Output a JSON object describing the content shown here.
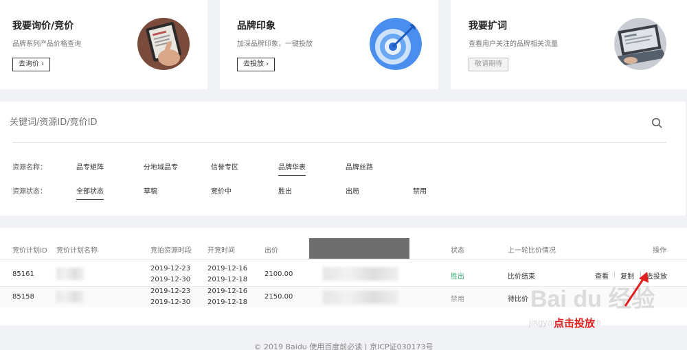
{
  "cards": [
    {
      "title": "我要询价/竞价",
      "desc": "品牌系列产品价格查询",
      "button": "去询价 ›"
    },
    {
      "title": "品牌印象",
      "desc": "加深品牌印象，一键投放",
      "button": "去投放 ›"
    },
    {
      "title": "我要扩词",
      "desc": "查看用户关注的品牌相关流量",
      "button": "敬请期待"
    }
  ],
  "search": {
    "placeholder": "关键词/资源ID/竞价ID"
  },
  "filters": {
    "name_label": "资源名称：",
    "name_options": [
      "品专矩阵",
      "分地域品专",
      "信誉专区",
      "品牌华表",
      "品牌丝路"
    ],
    "status_label": "资源状态：",
    "status_options": [
      "全部状态",
      "草稿",
      "竞价中",
      "胜出",
      "出局",
      "禁用"
    ]
  },
  "table": {
    "headers": [
      "竞价计划ID",
      "竞价计划名称",
      "竞拍资源时段",
      "开竞时间",
      "出价",
      "状态",
      "上一轮比价情况",
      "操作"
    ],
    "rows": [
      {
        "id": "85161",
        "period_start": "2019-12-23",
        "period_end": "2019-12-30",
        "open_start": "2019-12-16",
        "open_end": "2019-12-18",
        "bid": "2100.00",
        "status": "胜出",
        "last_round": "比价结束",
        "ops": [
          "查看",
          "复制",
          "去投放"
        ]
      },
      {
        "id": "85158",
        "period_start": "2019-12-23",
        "period_end": "2019-12-30",
        "open_start": "2019-12-16",
        "open_end": "2019-12-18",
        "bid": "2150.00",
        "status": "禁用",
        "last_round": "待比价",
        "ops": []
      }
    ]
  },
  "footer": "© 2019 Baidu  使用百度前必读 | 京ICP证030173号",
  "annotation": "点击投放",
  "watermark": {
    "main": "Bai du 经验",
    "sub": "jingyan.baidu.com"
  },
  "colors": {
    "win": "#3bb07a",
    "annotation": "#e02020"
  }
}
